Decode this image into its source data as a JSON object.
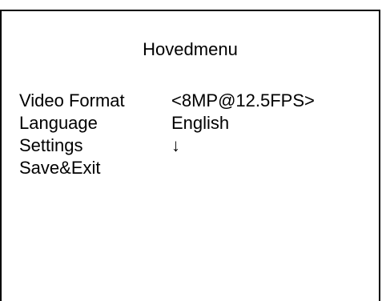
{
  "menu": {
    "title": "Hovedmenu",
    "items": [
      {
        "label": "Video Format",
        "value": "<8MP@12.5FPS>"
      },
      {
        "label": "Language",
        "value": "English"
      },
      {
        "label": "Settings",
        "value": "↓"
      },
      {
        "label": "Save&Exit",
        "value": ""
      }
    ]
  }
}
